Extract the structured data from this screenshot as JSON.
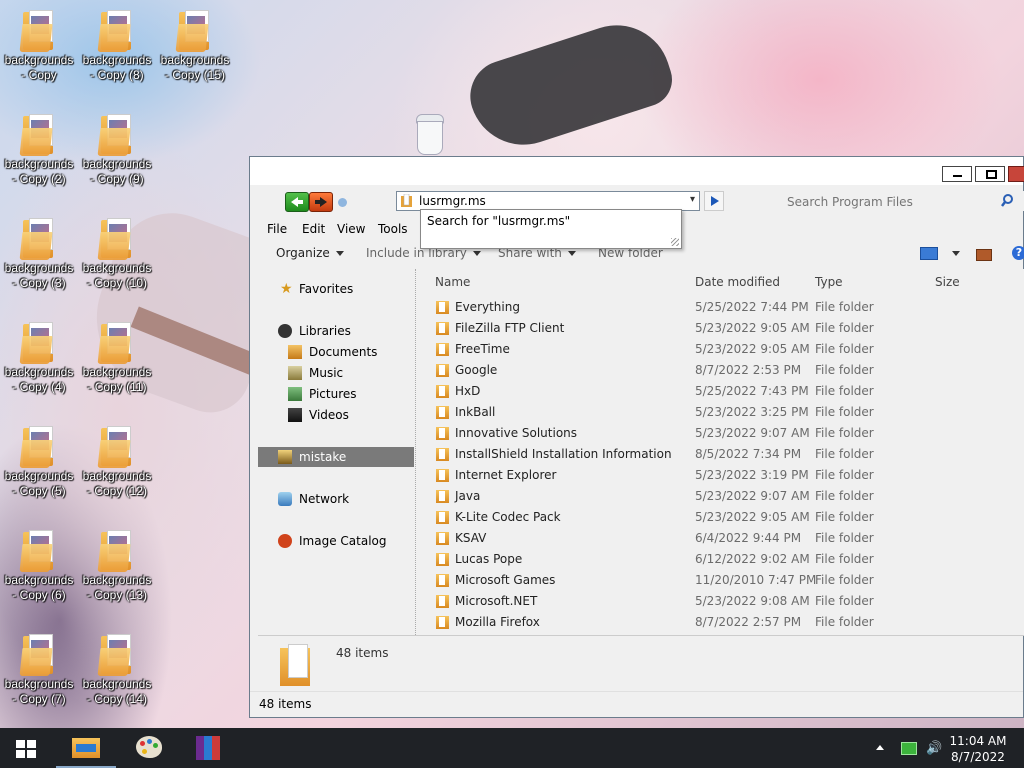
{
  "desktop": {
    "icons": [
      {
        "line1": "backgrounds",
        "line2": "- Copy"
      },
      {
        "line1": "backgrounds",
        "line2": "- Copy (8)"
      },
      {
        "line1": "backgrounds",
        "line2": "- Copy (15)"
      },
      {
        "line1": "backgrounds",
        "line2": "- Copy (2)"
      },
      {
        "line1": "backgrounds",
        "line2": "- Copy (9)"
      },
      {
        "line1": "backgrounds",
        "line2": "- Copy (3)"
      },
      {
        "line1": "backgrounds",
        "line2": "- Copy (10)"
      },
      {
        "line1": "backgrounds",
        "line2": "- Copy (4)"
      },
      {
        "line1": "backgrounds",
        "line2": "- Copy (11)"
      },
      {
        "line1": "backgrounds",
        "line2": "- Copy (5)"
      },
      {
        "line1": "backgrounds",
        "line2": "- Copy (12)"
      },
      {
        "line1": "backgrounds",
        "line2": "- Copy (6)"
      },
      {
        "line1": "backgrounds",
        "line2": "- Copy (13)"
      },
      {
        "line1": "backgrounds",
        "line2": "- Copy (7)"
      },
      {
        "line1": "backgrounds",
        "line2": "- Copy (14)"
      }
    ]
  },
  "window": {
    "address": {
      "value": "lusrmgr.ms",
      "suggestion": "Search for \"lusrmgr.ms\""
    },
    "search": {
      "placeholder": "Search Program Files"
    },
    "menu": [
      "File",
      "Edit",
      "View",
      "Tools"
    ],
    "toolbar": {
      "organize": "Organize",
      "include": "Include in library",
      "share": "Share with",
      "newfolder": "New folder"
    },
    "nav": {
      "favorites": "Favorites",
      "libraries": "Libraries",
      "documents": "Documents",
      "music": "Music",
      "pictures": "Pictures",
      "videos": "Videos",
      "mistake": "mistake",
      "network": "Network",
      "catalog": "Image Catalog"
    },
    "columns": {
      "name": "Name",
      "date": "Date modified",
      "type": "Type",
      "size": "Size"
    },
    "files": [
      {
        "name": "Everything",
        "date": "5/25/2022 7:44 PM",
        "type": "File folder"
      },
      {
        "name": "FileZilla FTP Client",
        "date": "5/23/2022 9:05 AM",
        "type": "File folder"
      },
      {
        "name": "FreeTime",
        "date": "5/23/2022 9:05 AM",
        "type": "File folder"
      },
      {
        "name": "Google",
        "date": "8/7/2022 2:53 PM",
        "type": "File folder"
      },
      {
        "name": "HxD",
        "date": "5/25/2022 7:43 PM",
        "type": "File folder"
      },
      {
        "name": "InkBall",
        "date": "5/23/2022 3:25 PM",
        "type": "File folder"
      },
      {
        "name": "Innovative Solutions",
        "date": "5/23/2022 9:07 AM",
        "type": "File folder"
      },
      {
        "name": "InstallShield Installation Information",
        "date": "8/5/2022 7:34 PM",
        "type": "File folder"
      },
      {
        "name": "Internet Explorer",
        "date": "5/23/2022 3:19 PM",
        "type": "File folder"
      },
      {
        "name": "Java",
        "date": "5/23/2022 9:07 AM",
        "type": "File folder"
      },
      {
        "name": "K-Lite Codec Pack",
        "date": "5/23/2022 9:05 AM",
        "type": "File folder"
      },
      {
        "name": "KSAV",
        "date": "6/4/2022 9:44 PM",
        "type": "File folder"
      },
      {
        "name": "Lucas Pope",
        "date": "6/12/2022 9:02 AM",
        "type": "File folder"
      },
      {
        "name": "Microsoft Games",
        "date": "11/20/2010 7:47 PM",
        "type": "File folder"
      },
      {
        "name": "Microsoft.NET",
        "date": "5/23/2022 9:08 AM",
        "type": "File folder"
      },
      {
        "name": "Mozilla Firefox",
        "date": "8/7/2022 2:57 PM",
        "type": "File folder"
      }
    ],
    "details_count": "48 items",
    "status": "48 items"
  },
  "taskbar": {
    "time": "11:04 AM",
    "date": "8/7/2022"
  }
}
